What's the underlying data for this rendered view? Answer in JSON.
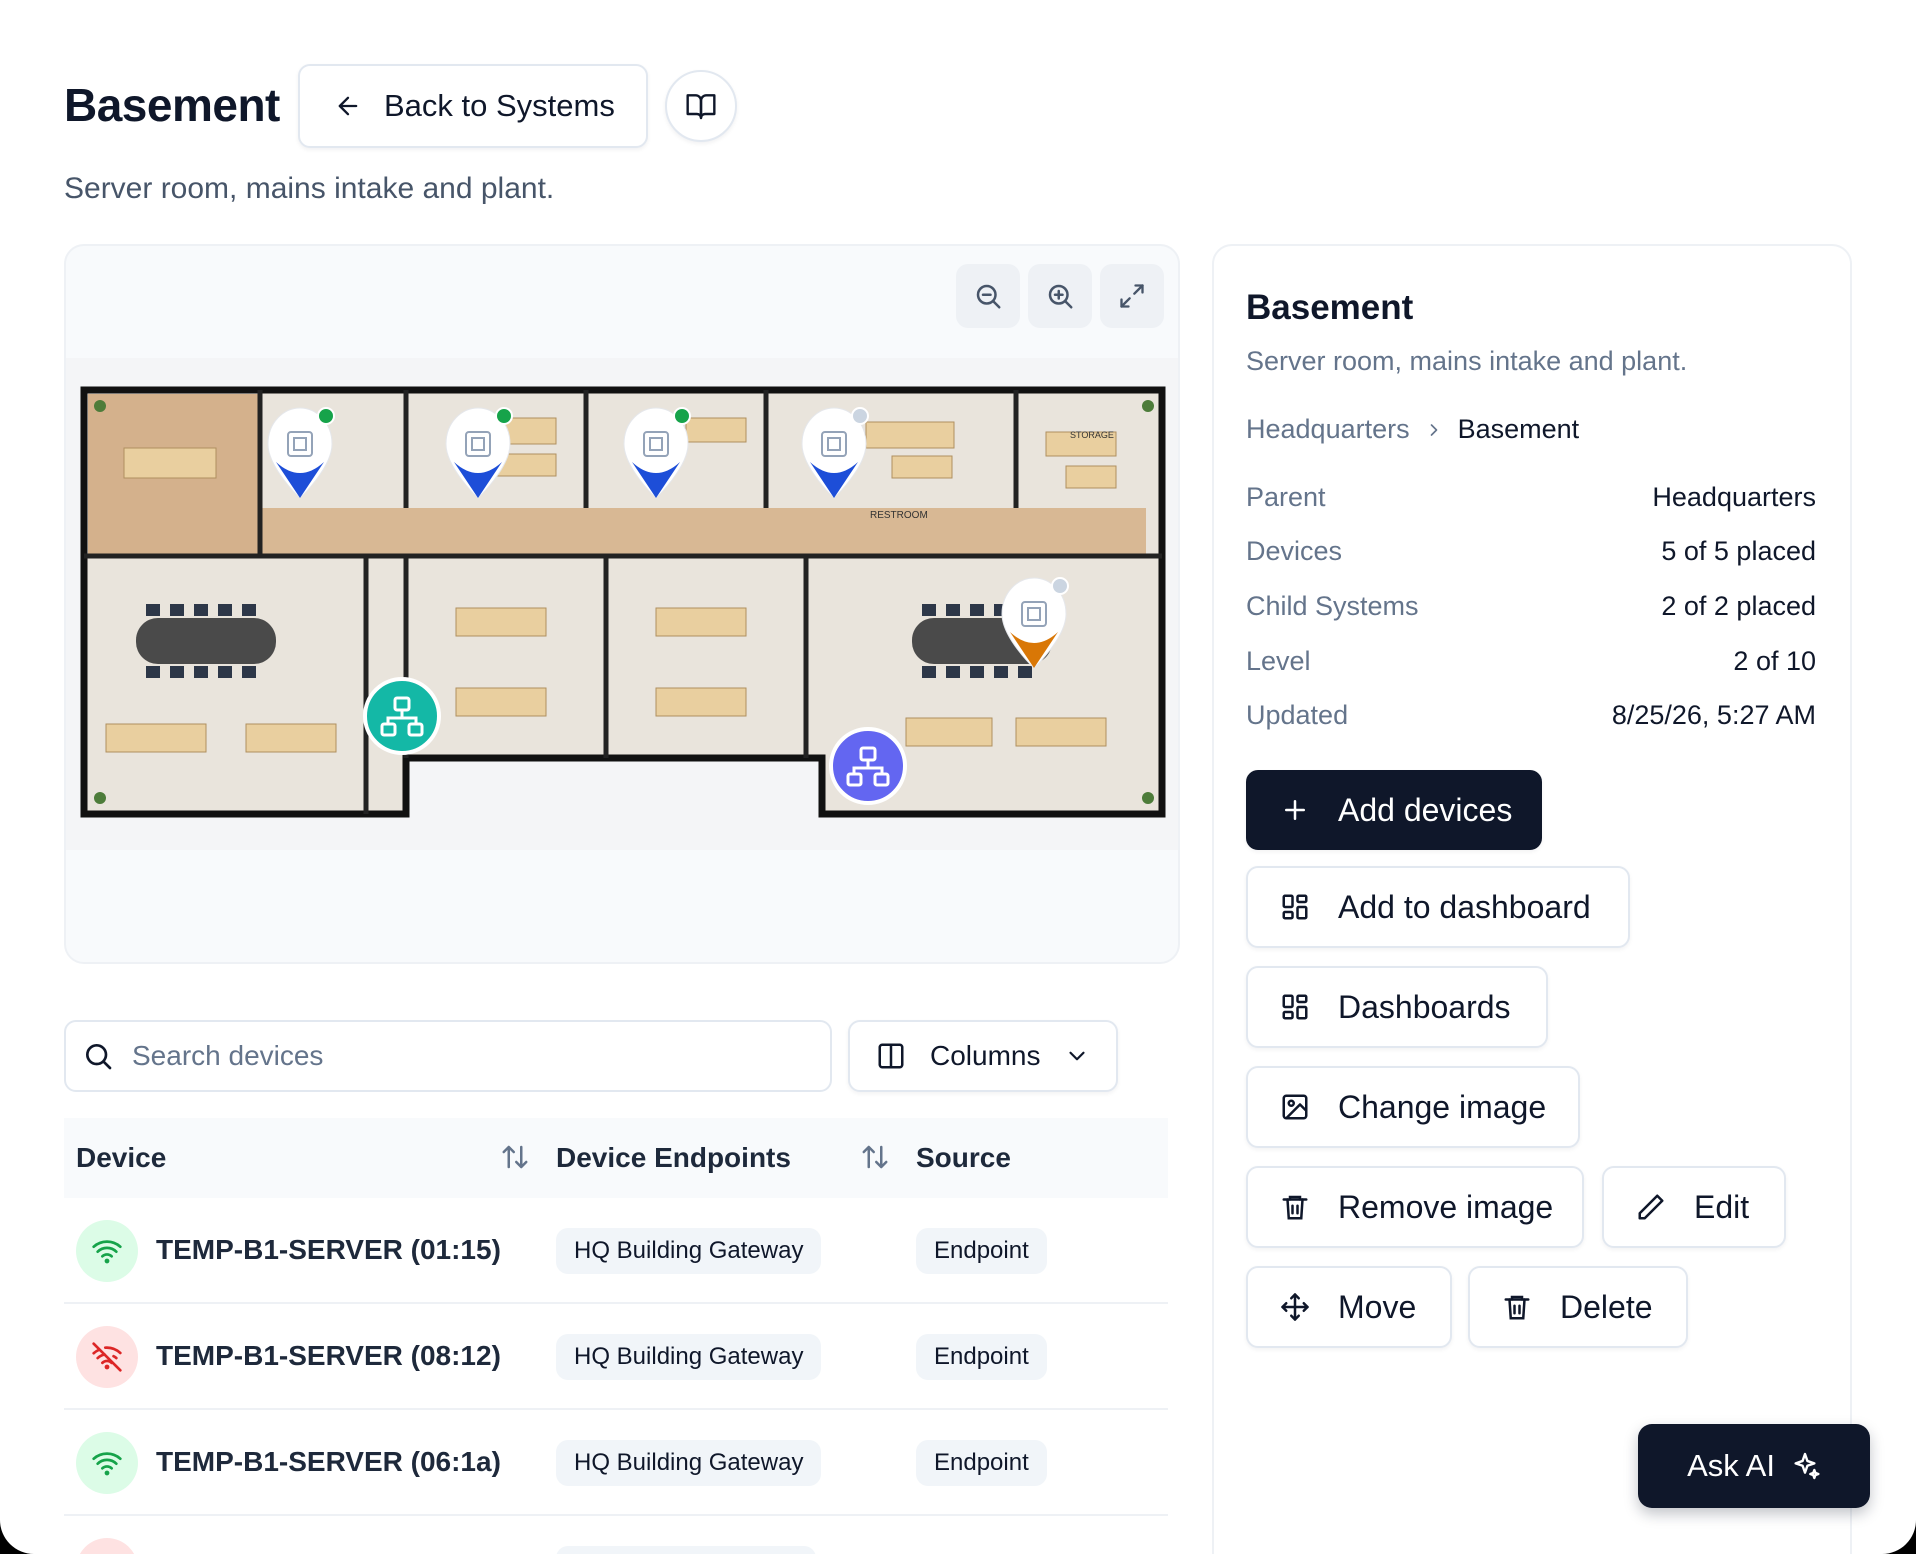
{
  "header": {
    "title": "Basement",
    "back_label": "Back to Systems",
    "subtitle": "Server room, mains intake and plant."
  },
  "map": {
    "room_label": "RESTROOM",
    "room_label_2": "STORAGE",
    "markers": [
      {
        "kind": "device",
        "color": "#1d4ed8",
        "status": "online"
      },
      {
        "kind": "device",
        "color": "#1d4ed8",
        "status": "online"
      },
      {
        "kind": "device",
        "color": "#1d4ed8",
        "status": "online"
      },
      {
        "kind": "device",
        "color": "#1d4ed8",
        "status": "offline"
      },
      {
        "kind": "device",
        "color": "#d97706",
        "status": "offline"
      },
      {
        "kind": "system",
        "color": "#14b8a6"
      },
      {
        "kind": "system",
        "color": "#6366f1"
      }
    ]
  },
  "search": {
    "placeholder": "Search devices"
  },
  "columns_label": "Columns",
  "table": {
    "headers": [
      "Device",
      "Device Endpoints",
      "Source"
    ],
    "rows": [
      {
        "name": "TEMP-B1-SERVER (01:15)",
        "endpoint": "HQ Building Gateway",
        "source": "Endpoint",
        "status": "online"
      },
      {
        "name": "TEMP-B1-SERVER (08:12)",
        "endpoint": "HQ Building Gateway",
        "source": "Endpoint",
        "status": "offline"
      },
      {
        "name": "TEMP-B1-SERVER (06:1a)",
        "endpoint": "HQ Building Gateway",
        "source": "Endpoint",
        "status": "online"
      }
    ]
  },
  "panel": {
    "title": "Basement",
    "description": "Server room, mains intake and plant.",
    "breadcrumb": [
      "Headquarters",
      "Basement"
    ],
    "details": [
      {
        "key": "Parent",
        "value": "Headquarters"
      },
      {
        "key": "Devices",
        "value": "5 of 5 placed"
      },
      {
        "key": "Child Systems",
        "value": "2 of 2 placed"
      },
      {
        "key": "Level",
        "value": "2 of 10"
      },
      {
        "key": "Updated",
        "value": "8/25/26, 5:27 AM"
      }
    ],
    "actions": {
      "add_devices": "Add devices",
      "add_to_dashboard": "Add to dashboard",
      "dashboards": "Dashboards",
      "change_image": "Change image",
      "remove_image": "Remove image",
      "edit": "Edit",
      "move": "Move",
      "delete": "Delete"
    }
  },
  "ask_ai": "Ask AI",
  "colors": {
    "primary": "#0f172a",
    "online": "#16a34a",
    "offline": "#dc2626",
    "marker_blue": "#1d4ed8",
    "marker_orange": "#d97706",
    "system_teal": "#14b8a6",
    "system_indigo": "#6366f1"
  }
}
